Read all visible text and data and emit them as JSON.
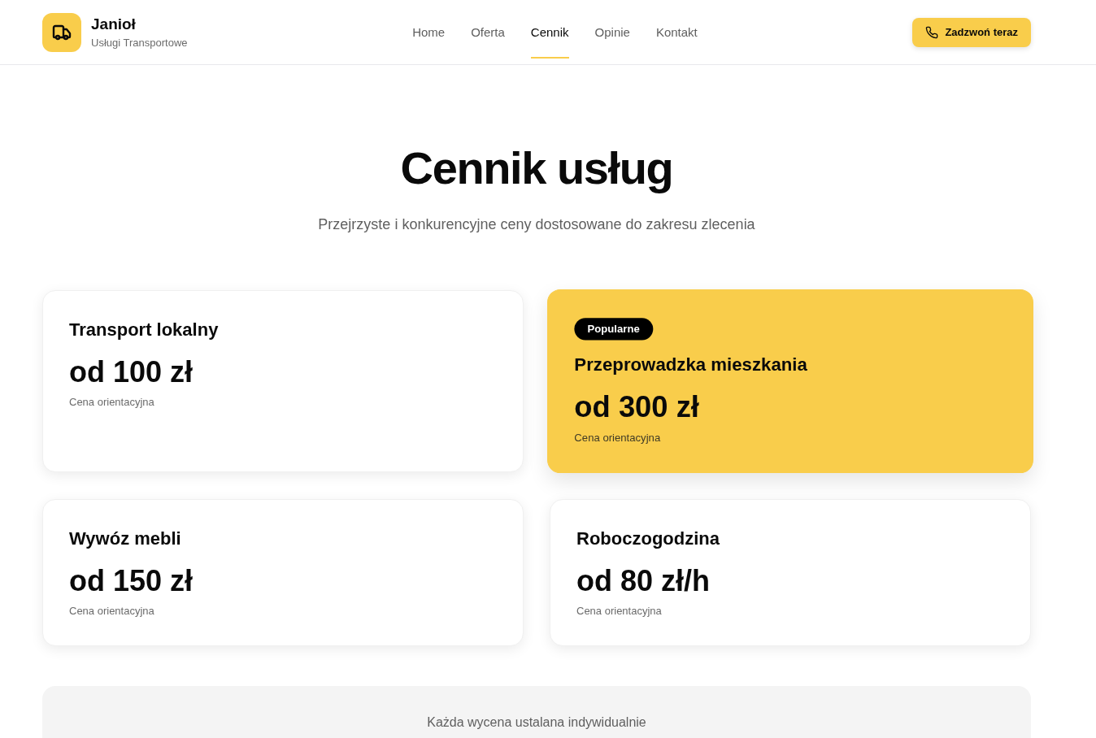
{
  "header": {
    "brand": {
      "name": "Janioł",
      "tagline": "Usługi Transportowe"
    },
    "nav": [
      {
        "label": "Home",
        "selected": false
      },
      {
        "label": "Oferta",
        "selected": false
      },
      {
        "label": "Cennik",
        "selected": true
      },
      {
        "label": "Opinie",
        "selected": false
      },
      {
        "label": "Kontakt",
        "selected": false
      }
    ],
    "cta": {
      "label": "Zadzwoń teraz"
    }
  },
  "hero": {
    "title": "Cennik usług",
    "subtitle": "Przejrzyste i konkurencyjne ceny dostosowane do zakresu zlecenia"
  },
  "pricing_cards": [
    {
      "title": "Transport lokalny",
      "price": "od 100 zł",
      "note": "Cena orientacyjna",
      "highlighted": false
    },
    {
      "badge": "Popularne",
      "title": "Przeprowadzka mieszkania",
      "price": "od 300 zł",
      "note": "Cena orientacyjna",
      "highlighted": true
    },
    {
      "title": "Wywóz mebli",
      "price": "od 150 zł",
      "note": "Cena orientacyjna",
      "highlighted": false
    },
    {
      "title": "Roboczogodzina",
      "price": "od 80 zł/h",
      "note": "Cena orientacyjna",
      "highlighted": false
    }
  ],
  "notice": {
    "text": "Każda wycena ustalana indywidualnie"
  }
}
